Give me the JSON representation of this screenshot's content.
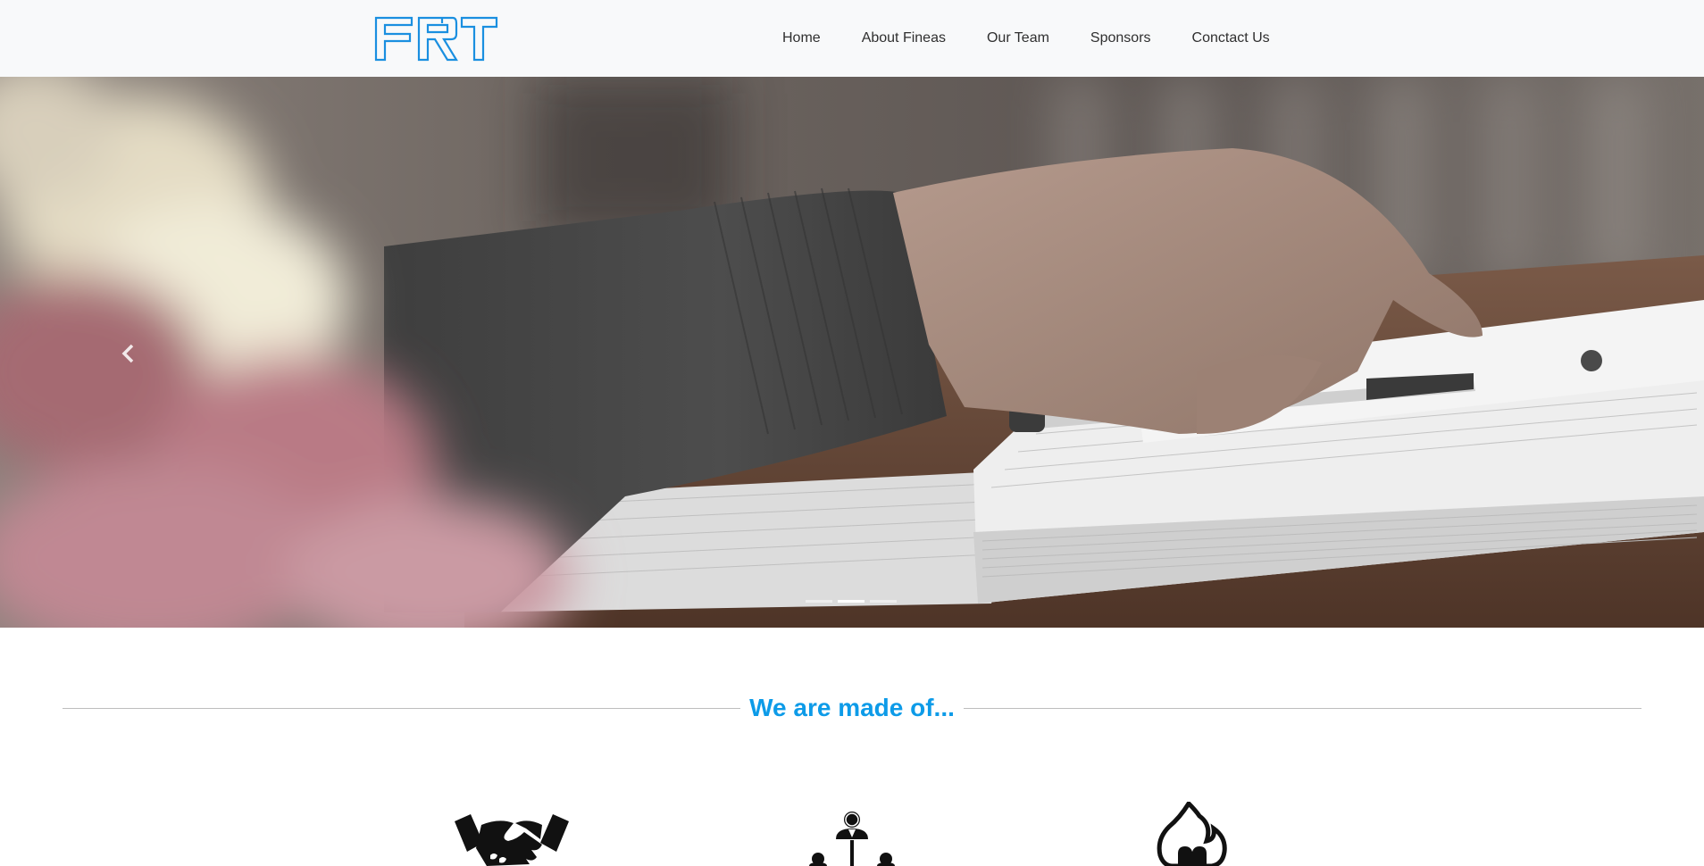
{
  "logo": {
    "alt_text": "FRT",
    "color": "#1a8fe0"
  },
  "nav": {
    "items": [
      {
        "label": "Home"
      },
      {
        "label": "About Fineas"
      },
      {
        "label": "Our Team"
      },
      {
        "label": "Sponsors"
      },
      {
        "label": "Conctact Us"
      }
    ]
  },
  "carousel": {
    "slide_count": 3,
    "active_index": 1,
    "prev_icon": "chevron-left-icon",
    "next_icon": "chevron-right-icon"
  },
  "section": {
    "title": "We are made of...",
    "title_color": "#0d9be8"
  },
  "features": {
    "icons": [
      "handshake-icon",
      "team-hierarchy-icon",
      "flame-heart-icon"
    ]
  }
}
